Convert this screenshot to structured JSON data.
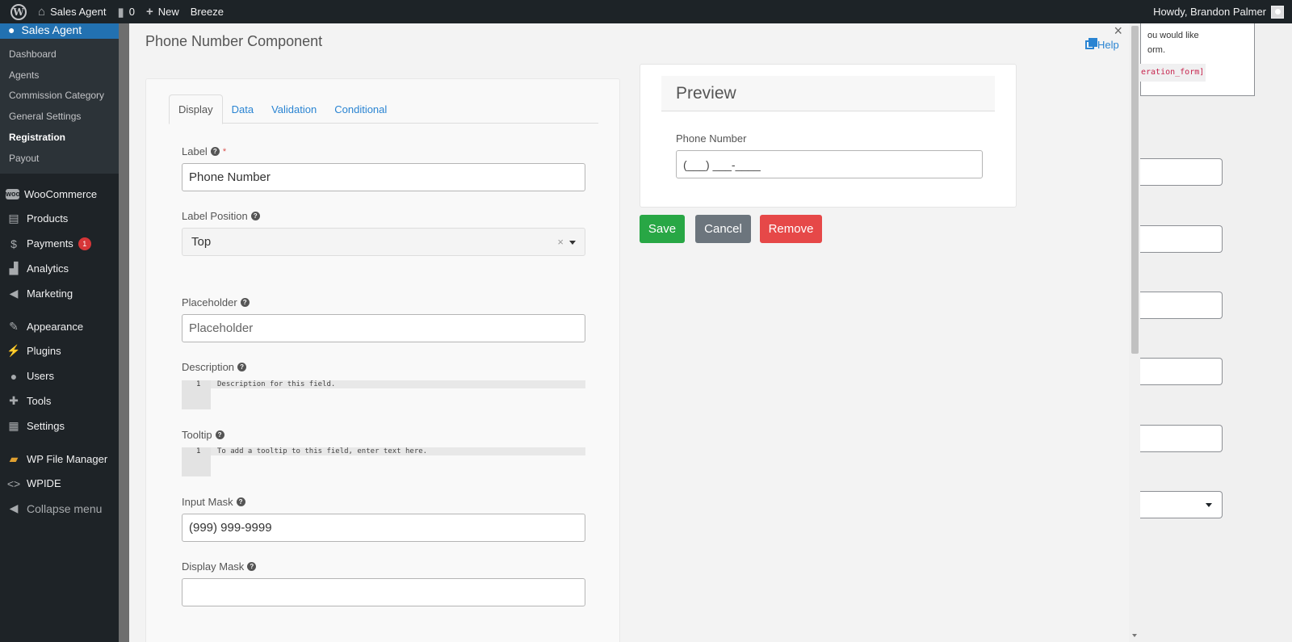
{
  "adminbar": {
    "site_name": "Sales Agent",
    "comments_count": "0",
    "new_label": "New",
    "plugin_label": "Breeze",
    "howdy": "Howdy, Brandon Palmer"
  },
  "sidebar": {
    "current": "Sales Agent",
    "submenu": [
      "Dashboard",
      "Agents",
      "Commission Category",
      "General Settings",
      "Registration",
      "Payout"
    ],
    "active_sub": "Registration",
    "menu": [
      {
        "label": "WooCommerce",
        "icon": "woo-icon"
      },
      {
        "label": "Products",
        "icon": "archive-icon"
      },
      {
        "label": "Payments",
        "icon": "dollar-icon",
        "badge": "1"
      },
      {
        "label": "Analytics",
        "icon": "bar-chart-icon"
      },
      {
        "label": "Marketing",
        "icon": "megaphone-icon"
      },
      {
        "label": "Appearance",
        "icon": "brush-icon"
      },
      {
        "label": "Plugins",
        "icon": "plug-icon"
      },
      {
        "label": "Users",
        "icon": "user-icon"
      },
      {
        "label": "Tools",
        "icon": "wrench-icon"
      },
      {
        "label": "Settings",
        "icon": "sliders-icon"
      },
      {
        "label": "WP File Manager",
        "icon": "folder-icon"
      },
      {
        "label": "WPIDE",
        "icon": "code-icon"
      }
    ],
    "collapse": "Collapse menu"
  },
  "background": {
    "notice_line1": "ou would like",
    "notice_line2": "orm.",
    "shortcode": "eration_form]"
  },
  "modal": {
    "title": "Phone Number Component",
    "help": "Help",
    "close": "×",
    "tabs": [
      "Display",
      "Data",
      "Validation",
      "Conditional"
    ],
    "active_tab": "Display",
    "fields": {
      "label": {
        "label": "Label",
        "value": "Phone Number",
        "required": "*"
      },
      "label_position": {
        "label": "Label Position",
        "value": "Top",
        "clear": "×"
      },
      "placeholder": {
        "label": "Placeholder",
        "placeholder": "Placeholder"
      },
      "description": {
        "label": "Description",
        "line_no": "1",
        "text": "Description for this field."
      },
      "tooltip": {
        "label": "Tooltip",
        "line_no": "1",
        "text": "To add a tooltip to this field, enter text here."
      },
      "input_mask": {
        "label": "Input Mask",
        "value": "(999) 999-9999"
      },
      "display_mask": {
        "label": "Display Mask",
        "value": ""
      }
    },
    "preview": {
      "title": "Preview",
      "field_label": "Phone Number",
      "field_value": "(___) ___-____"
    },
    "buttons": {
      "save": "Save",
      "cancel": "Cancel",
      "remove": "Remove"
    }
  },
  "colors": {
    "wp_blue": "#2271b1",
    "link": "#2a84d2",
    "save": "#28a745",
    "cancel": "#6c757d",
    "remove": "#e64848"
  }
}
